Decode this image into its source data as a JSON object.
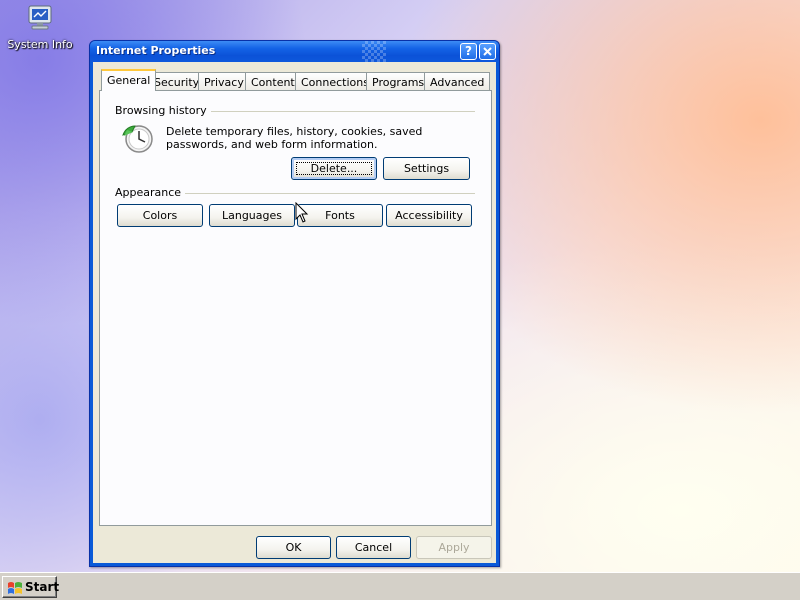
{
  "desktop": {
    "icons": [
      {
        "label": "System Info",
        "icon": "monitor-icon"
      }
    ]
  },
  "window": {
    "title": "Internet Properties",
    "help_label": "?",
    "close_label": "✕",
    "tabs": [
      {
        "label": "General",
        "active": true
      },
      {
        "label": "Security"
      },
      {
        "label": "Privacy"
      },
      {
        "label": "Content"
      },
      {
        "label": "Connections"
      },
      {
        "label": "Programs"
      },
      {
        "label": "Advanced"
      }
    ],
    "browsing_history": {
      "heading": "Browsing history",
      "description": "Delete temporary files, history, cookies, saved passwords, and web form information.",
      "icon": "history-clock-icon",
      "delete_label": "Delete...",
      "settings_label": "Settings"
    },
    "appearance": {
      "heading": "Appearance",
      "buttons": [
        "Colors",
        "Languages",
        "Fonts",
        "Accessibility"
      ]
    },
    "footer": {
      "ok_label": "OK",
      "cancel_label": "Cancel",
      "apply_label": "Apply",
      "apply_enabled": false
    }
  },
  "taskbar": {
    "start_label": "Start"
  },
  "colors": {
    "titlebar": "#0b52d8",
    "dialog_bg": "#ece9d8",
    "panel_bg": "#fcfcfe",
    "active_tab_accent": "#ffc83c"
  }
}
